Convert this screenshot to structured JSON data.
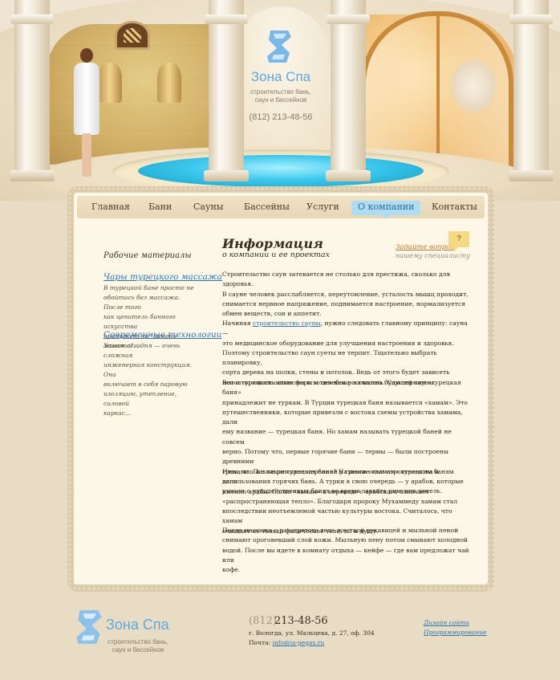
{
  "brand": {
    "name": "Зона Спа",
    "tagline_line1": "строительство бань,",
    "tagline_line2": "саун и бассейнов",
    "phone": "(812) 213-48-56",
    "logo_color": "#5ea9dd"
  },
  "nav": {
    "items": [
      {
        "label": "Главная"
      },
      {
        "label": "Бани"
      },
      {
        "label": "Сауны"
      },
      {
        "label": "Бассейны"
      },
      {
        "label": "Услуги"
      },
      {
        "label": "О компании",
        "active": true
      },
      {
        "label": "Контакты"
      }
    ],
    "active_color": "#aedcf3"
  },
  "sidebar": {
    "title": "Рабочие материалы",
    "articles": [
      {
        "title": "Чары турецкого массажа",
        "text_lines": [
          "В турецкой бане просто не",
          "обойтись без массажа. После того",
          "как ценитель банного искусства",
          "приляжет на \"камень живота\"..."
        ]
      },
      {
        "title": "Современные технологии",
        "text_lines": [
          "Хамам сегодня — очень сложная",
          "инженерная конструкция. Она",
          "включает в себя паровую",
          "изоляцию, утепление, силовой",
          "каркас..."
        ]
      }
    ]
  },
  "content": {
    "title": "Информация",
    "subtitle": "о компании и ее проектах",
    "ask": {
      "link": "Задайте вопрос",
      "sub": "нашему специалисту",
      "icon": "question-mark",
      "glyph": "?"
    },
    "paragraphs": [
      {
        "lines": [
          "Строительство саун затевается не столько для престижа, сколько для здоровья.",
          "В сауне человек расслабляется, переутомление, усталость мышц проходит,",
          "снимается нервное напряжение, поднимается настроение, нормализуется",
          "обмен веществ, сон и аппетит."
        ]
      },
      {
        "lines_before_link": "Начиная ",
        "link": "строительство сауны",
        "lines_after_link": ", нужно следовать главному принципу: сауна —",
        "lines": [
          "это медицинское оборудование для улучшения настроения и здоровья.",
          "Поэтому строительство саун суеты не терпит. Тщательно выбрать планировку,",
          "сорта дерева на полки, стены и потолок. Ведь от этого будет зависеть",
          "неповторимость атмосферы и целебные качества будущей сауны."
        ]
      },
      {
        "lines": [
          "Вот о турецком опыте мы и хотим вам рассказать. Сам термин «турецкая баня»",
          "принадлежит не туркам. В Турции турецкая баня называется «хамам». Это",
          "путешественники, которые привезли с востока схемы устройства хамама, дали",
          "ему название — турецкая баня. Но хамам называть турецкой баней не совсем",
          "верно. Потому что, первые горячие бани — термы — были построены древними",
          "греками. Позже римляне переняли у греков опыт строительства и",
          "использования горячих бань. А турки в свою очередь — у арабов, которые",
          "узнали о чудодейственных банях во время захвата римских земель."
        ]
      },
      {
        "lines": [
          "Итак, что же такое турецкая баня? Название «хамам» турецким баням дали",
          "именно арабы. Слово «хамам» в переводе с арабского означает",
          "«распространяющая тепло». Благодаря пророку Мухаммеду хамам стал",
          "впоследствии неотъемлемой частью культуры востока. Считалось, что хамам",
          "очищает не только физическое тело, но и душу."
        ]
      },
      {
        "lines": [
          "После массажа с разогретого тела жесткой рукавицей и мыльной пеной",
          "снимают ороговевший слой кожи. Мыльную пену потом смывают холодной",
          "водой. После вы идете в комнату отдыха — кейфе — где вам предложат чай или",
          "кофе."
        ]
      }
    ]
  },
  "footer": {
    "phone_code": "(812)",
    "phone_number": "213-48-56",
    "address": "г. Вологда, ул. Мальцева, д. 27, оф. 304",
    "mail_label": "Почта:",
    "mail": "info@ia-pegas.ru",
    "links": [
      {
        "label": "Дизайн сайта"
      },
      {
        "label": "Программирование"
      }
    ]
  }
}
